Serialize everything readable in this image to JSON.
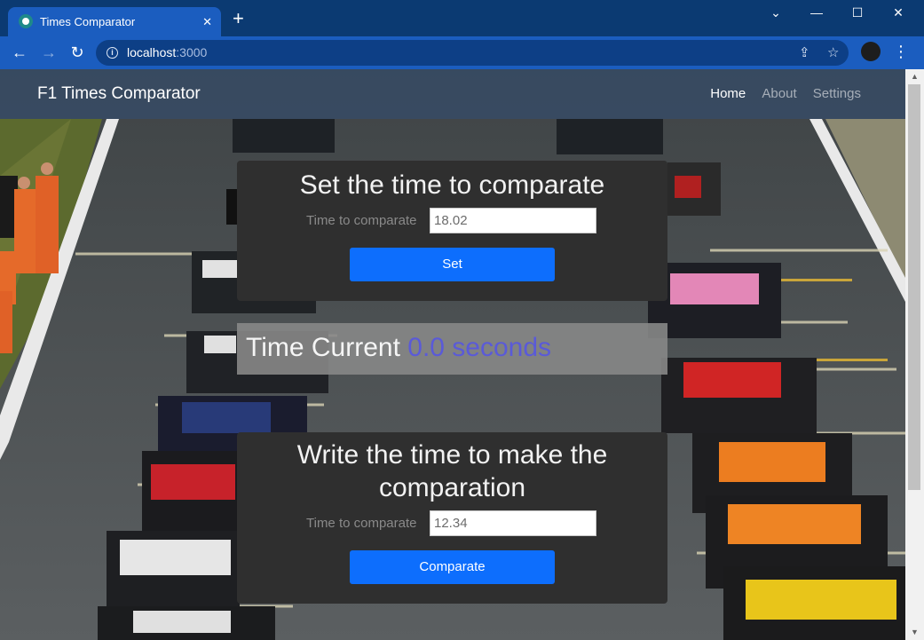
{
  "browser": {
    "tab_title": "Times Comparator",
    "tab_close": "✕",
    "new_tab": "+",
    "url_host": "localhost",
    "url_port": ":3000",
    "controls": {
      "minimize": "—",
      "maximize": "☐",
      "close": "✕",
      "chevron": "⌄"
    },
    "nav": {
      "back": "←",
      "forward": "→",
      "reload": "↻"
    },
    "info_glyph": "i",
    "share_glyph": "⇪",
    "star_glyph": "☆",
    "menu_glyph": "⋮"
  },
  "app": {
    "brand": "F1 Times Comparator",
    "nav": [
      {
        "label": "Home",
        "active": true
      },
      {
        "label": "About",
        "active": false
      },
      {
        "label": "Settings",
        "active": false
      }
    ]
  },
  "set_card": {
    "title": "Set the time to comparate",
    "label": "Time to comparate",
    "value": "18.02",
    "button": "Set"
  },
  "current": {
    "label": "Time Current",
    "value": "0.0 seconds"
  },
  "compare_card": {
    "title_line1": "Write the time to make the",
    "title_line2": "comparation",
    "label": "Time to comparate",
    "value": "12.34",
    "button": "Comparate"
  },
  "colors": {
    "browser_frame": "#0b3a72",
    "browser_toolbar": "#1b5dbf",
    "card": "#2f2f2f",
    "primary_button": "#0d6efd",
    "current_value": "#5a5ad8"
  }
}
